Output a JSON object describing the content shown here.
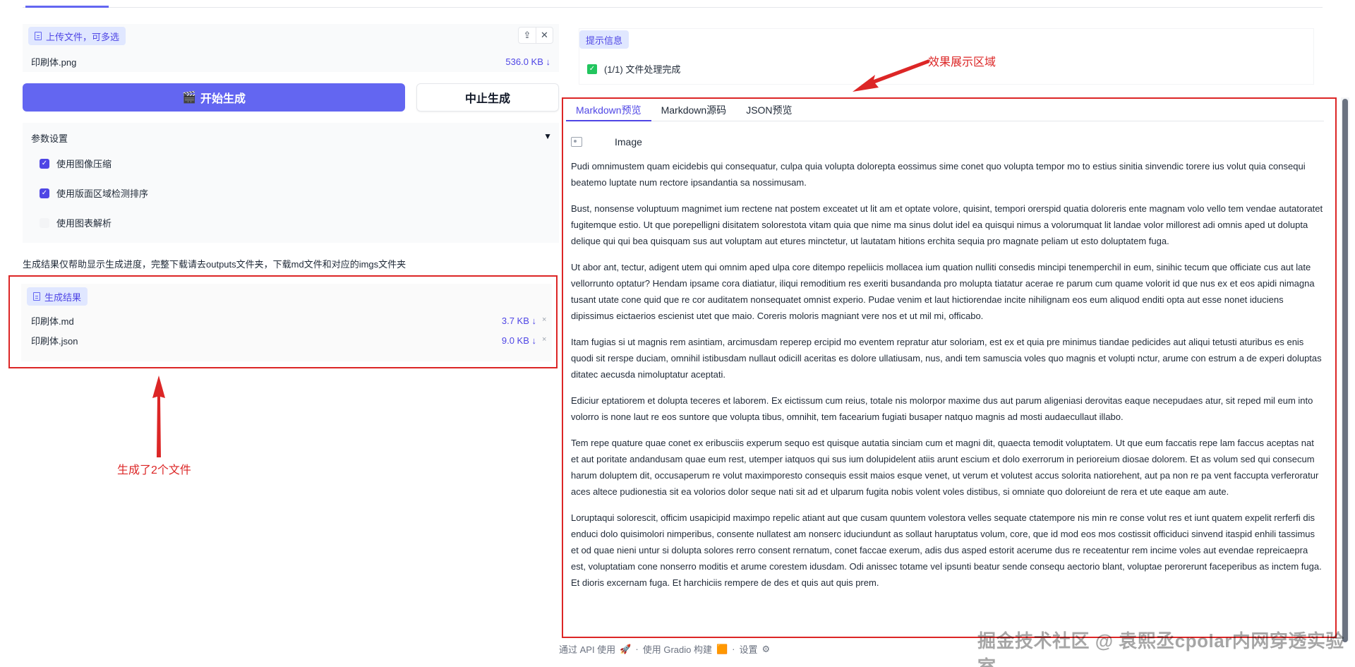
{
  "upload": {
    "label": "上传文件，可多选",
    "file": {
      "name": "印刷体.png",
      "size": "536.0 KB ↓"
    },
    "tools": {
      "upload_glyph": "⇪",
      "close_glyph": "✕"
    }
  },
  "actions": {
    "start_icon": "🎬",
    "start_label": "开始生成",
    "stop_label": "中止生成"
  },
  "params": {
    "title": "参数设置",
    "caret": "▼",
    "options": [
      {
        "label": "使用图像压缩",
        "checked": true
      },
      {
        "label": "使用版面区域检测排序",
        "checked": true
      },
      {
        "label": "使用图表解析",
        "checked": false
      }
    ]
  },
  "note": "生成结果仅帮助显示生成进度，完整下载请去outputs文件夹，下载md文件和对应的imgs文件夹",
  "results": {
    "label": "生成结果",
    "files": [
      {
        "name": "印刷体.md",
        "size": "3.7 KB ↓"
      },
      {
        "name": "印刷体.json",
        "size": "9.0 KB ↓"
      }
    ],
    "remove_glyph": "×"
  },
  "annotations": {
    "left": "生成了2个文件",
    "right": "效果展示区域"
  },
  "hint": {
    "label": "提示信息",
    "message": "(1/1) 文件处理完成"
  },
  "tabs": [
    "Markdown预览",
    "Markdown源码",
    "JSON预览"
  ],
  "markdown": {
    "image_alt": "Image",
    "paragraphs": [
      "Pudi omnimustem quam eicidebis qui consequatur, culpa quia volupta dolorepta eossimus sime conet quo volupta tempor mo to estius sinitia sinvendic torere ius volut quia consequi beatemo luptate num rectore ipsandantia sa nossimusam.",
      "Bust, nonsense voluptuum magnimet ium rectene nat postem exceatet ut lit am et optate volore, quisint, tempori orerspid quatia doloreris ente magnam volo vello tem vendae autatoratet fugitemque estio. Ut que porepelligni disitatem solorestota vitam quia que nime ma sinus dolut idel ea quisqui nimus a volorumquat lit landae volor millorest adi omnis aped ut dolupta delique qui qui bea quisquam sus aut voluptam aut etures minctetur, ut lautatam hitions erchita sequia pro magnate peliam ut esto doluptatem fuga.",
      "Ut abor ant, tectur, adigent utem qui omnim aped ulpa core ditempo repeliicis mollacea ium quation nulliti consedis mincipi tenemperchil in eum, sinihic tecum que officiate cus aut late vellorrunto optatur? Hendam ipsame cora diatiatur, iliqui remoditium res exeriti busandanda pro molupta tiatatur acerae re parum cum quame volorit id que nus ex et eos apidi nimagna tusant utate cone quid que re cor auditatem nonsequatet omnist experio. Pudae venim et laut hictiorendae incite nihilignam eos eum aliquod enditi opta aut esse nonet iduciens dipissimus eictaerios escienist utet que maio. Coreris moloris magniant vere nos et ut mil mi, officabo.",
      "Itam fugias si ut magnis rem asintiam, arcimusdam reperep ercipid mo eventem repratur atur soloriam, est ex et quia pre minimus tiandae pedicides aut aliqui tetusti aturibus es enis quodi sit rerspe duciam, omnihil istibusdam nullaut odicill aceritas es dolore ullatiusam, nus, andi tem samuscia voles quo magnis et volupti nctur, arume con estrum a de experi doluptas ditatec aecusda nimoluptatur aceptati.",
      "Ediciur eptatiorem et dolupta teceres et laborem. Ex eictissum cum reius, totale nis molorpor maxime dus aut parum aligeniasi derovitas eaque necepudaes atur, sit reped mil eum into volorro is none laut re eos suntore que volupta tibus, omnihit, tem facearium fugiati busaper natquo magnis ad mosti audaecullaut illabo.",
      "Tem repe quature quae conet ex eribusciis experum sequo est quisque autatia sinciam cum et magni dit, quaecta temodit voluptatem. Ut que eum faccatis repe lam faccus aceptas nat et aut poritate andandusam quae eum rest, utemper iatquos qui sus ium dolupidelent atiis arunt escium et dolo exerrorum in perioreium diosae dolorem. Et as volum sed qui consecum harum doluptem dit, occusaperum re volut maximporesto consequis essit maios esque venet, ut verum et volutest accus solorita natiorehent, aut pa non re pa vent faccupta verferoratur aces altece pudionestia sit ea volorios dolor seque nati sit ad et ulparum fugita nobis volent voles distibus, si omniate quo doloreiunt de rera et ute eaque am aute.",
      "Loruptaqui solorescit, officim usapicipid maximpo repelic atiant aut que cusam quuntem volestora velles sequate ctatempore nis min re conse volut res et iunt quatem expelit rerferfi dis enduci dolo quisimolori nimperibus, consente nullatest am nonserc iduciundunt as sollaut haruptatus volum, core, que id mod eos mos costissit officiduci sinvend itaspid enhili tassimus et od quae nieni untur si dolupta solores rerro consent rernatum, conet faccae exerum, adis dus asped estorit acerume dus re receatentur rem incime voles aut evendae repreicaepra est, voluptatiam cone nonserro moditis et arume corestem idusdam. Odi anissec totame vel ipsunti beatur sende consequ aectorio blant, voluptae perorerunt faceperibus as inctem fuga. Et dioris excernam fuga. Et harchiciis rempere de des et quis aut quis prem."
    ]
  },
  "footer": {
    "api": "通过 API 使用",
    "api_icon": "🚀",
    "sep": "·",
    "gradio": "使用 Gradio 构建",
    "gradio_icon": "🟧",
    "settings": "设置",
    "settings_icon": "⚙"
  },
  "watermark": "掘金技术社区 @ 袁熙丞cpolar内网穿透实验室",
  "colors": {
    "accent": "#6366f1",
    "annotation": "#dc2626",
    "success": "#22c55e"
  }
}
